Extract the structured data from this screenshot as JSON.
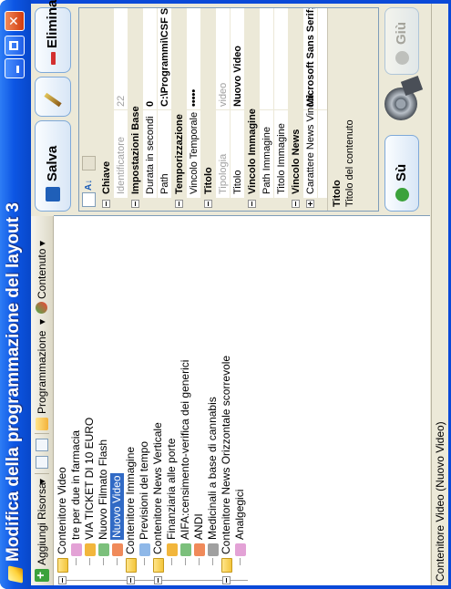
{
  "window": {
    "title": "Modifica della programmazione del layout 3",
    "controls": {
      "minimize": "_",
      "maximize": "□",
      "close": "✕"
    }
  },
  "toolbar": {
    "add_resource": "Aggiungi Risorsa",
    "dropdown_caret": "▾",
    "scheduling": "Programmazione",
    "content": "Contenuto"
  },
  "tree": [
    {
      "label": "Contenitore Video",
      "type": "container",
      "expanded": true
    },
    {
      "label": "tre per due in farmacia",
      "type": "item"
    },
    {
      "label": "VIA TICKET DI 10 EURO",
      "type": "item"
    },
    {
      "label": "Nuovo Filmato Flash",
      "type": "item"
    },
    {
      "label": "Nuovo Video",
      "type": "item",
      "selected": true
    },
    {
      "label": "Contenitore Immagine",
      "type": "container",
      "expanded": true
    },
    {
      "label": "Previsioni del tempo",
      "type": "item"
    },
    {
      "label": "Contenitore News Verticale",
      "type": "container",
      "expanded": true
    },
    {
      "label": "Finanziaria alle porte",
      "type": "item"
    },
    {
      "label": "AIFA:censimento-verifica dei generici",
      "type": "item"
    },
    {
      "label": "ANDI",
      "type": "item"
    },
    {
      "label": "Medicinali a base di cannabis",
      "type": "item"
    },
    {
      "label": "Contenitore News Orizzontale scorrevole",
      "type": "container",
      "expanded": true
    },
    {
      "label": "Analgegici",
      "type": "item"
    }
  ],
  "status": "Contenitore Video (Nuovo Video)",
  "actions": {
    "save": "Salva",
    "delete": "Elimina",
    "up": "Sù",
    "down": "Giù"
  },
  "properties": {
    "rows": [
      {
        "kind": "category",
        "label": "Chiave"
      },
      {
        "kind": "prop",
        "key": "Identificatore",
        "value": "22",
        "readonly": true
      },
      {
        "kind": "category",
        "label": "Impostazioni Base"
      },
      {
        "kind": "prop",
        "key": "Durata in secondi",
        "value": "0",
        "bold": true
      },
      {
        "kind": "prop",
        "key": "Path",
        "value": "C:\\Programmi\\CSF Si",
        "bold": true
      },
      {
        "kind": "category",
        "label": "Temporizzazione"
      },
      {
        "kind": "prop",
        "key": "Vincolo Temporale",
        "value": "•••••",
        "bold": true
      },
      {
        "kind": "category",
        "label": "Titolo"
      },
      {
        "kind": "prop",
        "key": "Tipologia",
        "value": "video",
        "readonly": true
      },
      {
        "kind": "prop",
        "key": "Titolo",
        "value": "Nuovo Video",
        "bold": true
      },
      {
        "kind": "category",
        "label": "Vincolo Immagine"
      },
      {
        "kind": "prop",
        "key": "Path Immagine",
        "value": ""
      },
      {
        "kind": "prop",
        "key": "Titolo Immagine",
        "value": ""
      },
      {
        "kind": "category",
        "label": "Vincolo News"
      },
      {
        "kind": "prop",
        "key": "Carattere News Vincol",
        "value": "Microsoft Sans Serif;",
        "bold": true,
        "collapsed": true
      }
    ],
    "description_title": "Titolo",
    "description_text": "Titolo del contenuto"
  },
  "colors": {
    "title_bar": "#0d56e4",
    "selection": "#316ac5",
    "delete_accent": "#d32f2f",
    "save_accent": "#1f5fb8"
  }
}
